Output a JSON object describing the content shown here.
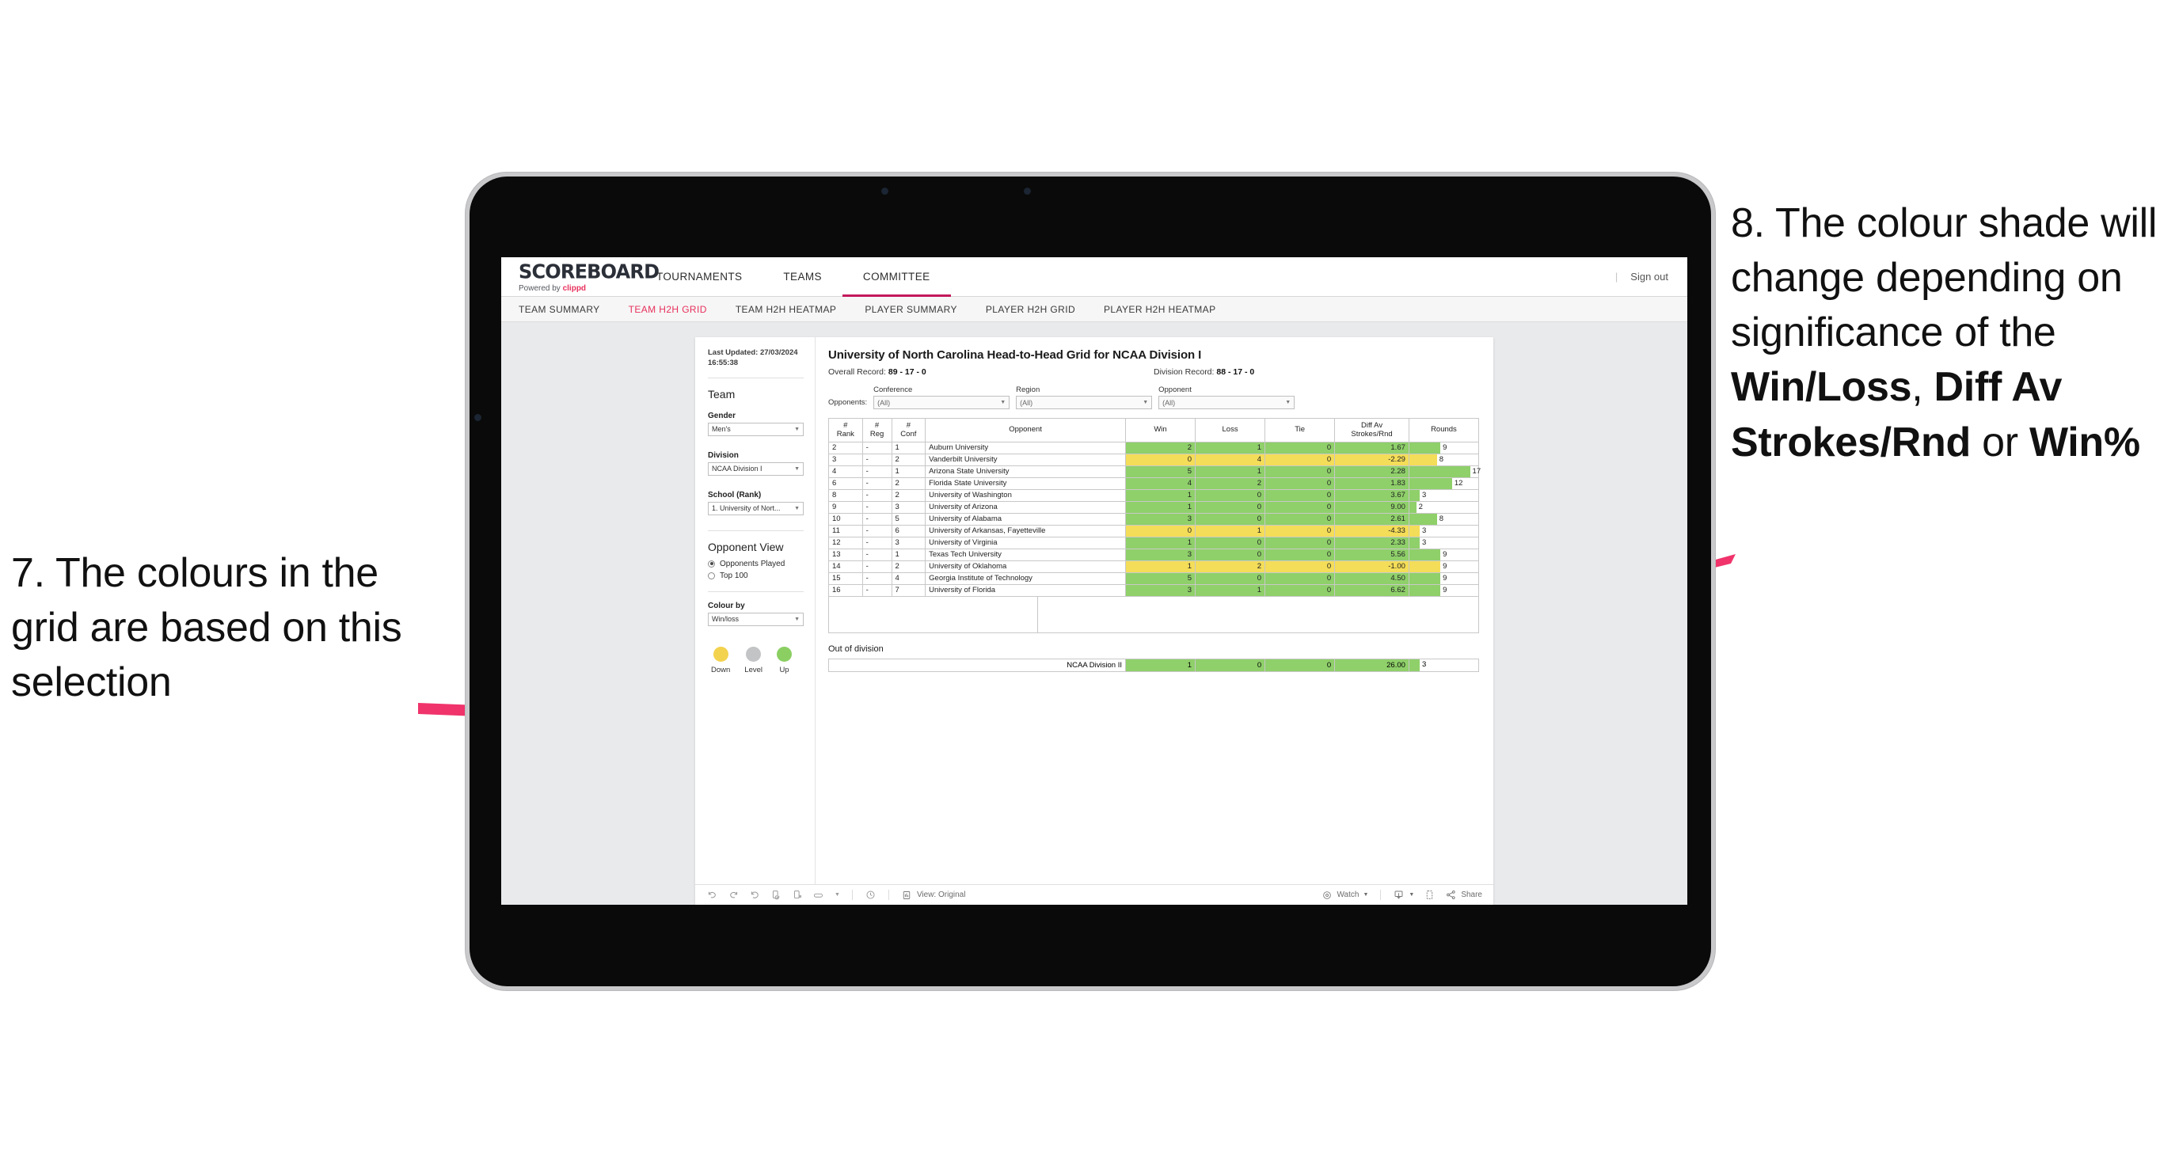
{
  "annotations": {
    "left": {
      "id": "annot-7",
      "text": "7. The colours in the grid are based on this selection"
    },
    "right": {
      "id": "annot-8",
      "lead": "8. The colour shade will change depending on significance of the ",
      "bold1": "Win/Loss",
      "mid1": ", ",
      "bold2": "Diff Av Strokes/Rnd",
      "mid2": " or ",
      "bold3": "Win%"
    },
    "accent_color": "#f0336b"
  },
  "app": {
    "brand": {
      "title": "SCOREBOARD",
      "powered_prefix": "Powered by ",
      "powered_name": "clippd"
    },
    "top_nav": [
      {
        "label": "TOURNAMENTS",
        "active": false
      },
      {
        "label": "TEAMS",
        "active": false
      },
      {
        "label": "COMMITTEE",
        "active": true
      }
    ],
    "sign_out": "Sign out",
    "sign_out_divider": "|",
    "sub_nav": [
      {
        "label": "TEAM SUMMARY",
        "active": false
      },
      {
        "label": "TEAM H2H GRID",
        "active": true
      },
      {
        "label": "TEAM H2H HEATMAP",
        "active": false
      },
      {
        "label": "PLAYER SUMMARY",
        "active": false
      },
      {
        "label": "PLAYER H2H GRID",
        "active": false
      },
      {
        "label": "PLAYER H2H HEATMAP",
        "active": false
      }
    ]
  },
  "panel": {
    "last_updated": "Last Updated: 27/03/2024 16:55:38",
    "team_heading": "Team",
    "gender": {
      "label": "Gender",
      "value": "Men's"
    },
    "division": {
      "label": "Division",
      "value": "NCAA Division I"
    },
    "school": {
      "label": "School (Rank)",
      "value": "1. University of Nort..."
    },
    "opponent_view": {
      "heading": "Opponent View",
      "options": [
        {
          "label": "Opponents Played",
          "selected": true
        },
        {
          "label": "Top 100",
          "selected": false
        }
      ]
    },
    "colour_by": {
      "label": "Colour by",
      "value": "Win/loss"
    },
    "legend": [
      {
        "label": "Down",
        "color": "#f3d24e"
      },
      {
        "label": "Level",
        "color": "#c2c4c6"
      },
      {
        "label": "Up",
        "color": "#8bcf63"
      }
    ]
  },
  "content": {
    "title": "University of North Carolina Head-to-Head Grid for NCAA Division I",
    "overall_record": {
      "label": "Overall Record: ",
      "value": "89 - 17 - 0"
    },
    "division_record": {
      "label": "Division Record: ",
      "value": "88 - 17 - 0"
    },
    "opponents_label": "Opponents:",
    "filters": [
      {
        "label": "Conference",
        "value": "(All)"
      },
      {
        "label": "Region",
        "value": "(All)"
      },
      {
        "label": "Opponent",
        "value": "(All)"
      }
    ],
    "table": {
      "headers": [
        "# Rank",
        "# Reg",
        "# Conf",
        "Opponent",
        "Win",
        "Loss",
        "Tie",
        "Diff Av Strokes/Rnd",
        "Rounds"
      ],
      "header_lines": [
        [
          "#",
          "Rank"
        ],
        [
          "#",
          "Reg"
        ],
        [
          "#",
          "Conf"
        ],
        [
          "Opponent"
        ],
        [
          "Win"
        ],
        [
          "Loss"
        ],
        [
          "Tie"
        ],
        [
          "Diff Av",
          "Strokes/Rnd"
        ],
        [
          "Rounds"
        ]
      ],
      "rows": [
        {
          "rank": "2",
          "reg": "-",
          "conf": "1",
          "opponent": "Auburn University",
          "win": "2",
          "loss": "1",
          "tie": "0",
          "diff": "1.67",
          "rounds": "9",
          "bar_pct": 45,
          "result": "win"
        },
        {
          "rank": "3",
          "reg": "-",
          "conf": "2",
          "opponent": "Vanderbilt University",
          "win": "0",
          "loss": "4",
          "tie": "0",
          "diff": "-2.29",
          "rounds": "8",
          "bar_pct": 40,
          "result": "loss"
        },
        {
          "rank": "4",
          "reg": "-",
          "conf": "1",
          "opponent": "Arizona State University",
          "win": "5",
          "loss": "1",
          "tie": "0",
          "diff": "2.28",
          "rounds": "17",
          "bar_pct": 88,
          "result": "win"
        },
        {
          "rank": "6",
          "reg": "-",
          "conf": "2",
          "opponent": "Florida State University",
          "win": "4",
          "loss": "2",
          "tie": "0",
          "diff": "1.83",
          "rounds": "12",
          "bar_pct": 62,
          "result": "win"
        },
        {
          "rank": "8",
          "reg": "-",
          "conf": "2",
          "opponent": "University of Washington",
          "win": "1",
          "loss": "0",
          "tie": "0",
          "diff": "3.67",
          "rounds": "3",
          "bar_pct": 15,
          "result": "win"
        },
        {
          "rank": "9",
          "reg": "-",
          "conf": "3",
          "opponent": "University of Arizona",
          "win": "1",
          "loss": "0",
          "tie": "0",
          "diff": "9.00",
          "rounds": "2",
          "bar_pct": 10,
          "result": "win"
        },
        {
          "rank": "10",
          "reg": "-",
          "conf": "5",
          "opponent": "University of Alabama",
          "win": "3",
          "loss": "0",
          "tie": "0",
          "diff": "2.61",
          "rounds": "8",
          "bar_pct": 40,
          "result": "win"
        },
        {
          "rank": "11",
          "reg": "-",
          "conf": "6",
          "opponent": "University of Arkansas, Fayetteville",
          "win": "0",
          "loss": "1",
          "tie": "0",
          "diff": "-4.33",
          "rounds": "3",
          "bar_pct": 15,
          "result": "loss"
        },
        {
          "rank": "12",
          "reg": "-",
          "conf": "3",
          "opponent": "University of Virginia",
          "win": "1",
          "loss": "0",
          "tie": "0",
          "diff": "2.33",
          "rounds": "3",
          "bar_pct": 15,
          "result": "win"
        },
        {
          "rank": "13",
          "reg": "-",
          "conf": "1",
          "opponent": "Texas Tech University",
          "win": "3",
          "loss": "0",
          "tie": "0",
          "diff": "5.56",
          "rounds": "9",
          "bar_pct": 45,
          "result": "win"
        },
        {
          "rank": "14",
          "reg": "-",
          "conf": "2",
          "opponent": "University of Oklahoma",
          "win": "1",
          "loss": "2",
          "tie": "0",
          "diff": "-1.00",
          "rounds": "9",
          "bar_pct": 45,
          "result": "loss"
        },
        {
          "rank": "15",
          "reg": "-",
          "conf": "4",
          "opponent": "Georgia Institute of Technology",
          "win": "5",
          "loss": "0",
          "tie": "0",
          "diff": "4.50",
          "rounds": "9",
          "bar_pct": 45,
          "result": "win"
        },
        {
          "rank": "16",
          "reg": "-",
          "conf": "7",
          "opponent": "University of Florida",
          "win": "3",
          "loss": "1",
          "tie": "0",
          "diff": "6.62",
          "rounds": "9",
          "bar_pct": 45,
          "result": "win"
        }
      ]
    },
    "out_of_division": {
      "title": "Out of division",
      "row": {
        "name": "NCAA Division II",
        "win": "1",
        "loss": "0",
        "tie": "0",
        "diff": "26.00",
        "rounds": "3",
        "bar_pct": 15
      }
    }
  },
  "toolbar": {
    "icons": [
      "undo-icon",
      "redo-icon",
      "revert-icon",
      "refresh-data-icon",
      "pause-icon",
      "highlight-icon"
    ],
    "view_label": "View: Original",
    "watch_label": "Watch",
    "share_label": "Share"
  },
  "chart_data": {
    "type": "table",
    "title": "University of North Carolina Head-to-Head Grid for NCAA Division I",
    "columns": [
      "# Rank",
      "# Reg",
      "# Conf",
      "Opponent",
      "Win",
      "Loss",
      "Tie",
      "Diff Av Strokes/Rnd",
      "Rounds"
    ],
    "rows": [
      [
        "2",
        "-",
        "1",
        "Auburn University",
        2,
        1,
        0,
        1.67,
        9
      ],
      [
        "3",
        "-",
        "2",
        "Vanderbilt University",
        0,
        4,
        0,
        -2.29,
        8
      ],
      [
        "4",
        "-",
        "1",
        "Arizona State University",
        5,
        1,
        0,
        2.28,
        17
      ],
      [
        "6",
        "-",
        "2",
        "Florida State University",
        4,
        2,
        0,
        1.83,
        12
      ],
      [
        "8",
        "-",
        "2",
        "University of Washington",
        1,
        0,
        0,
        3.67,
        3
      ],
      [
        "9",
        "-",
        "3",
        "University of Arizona",
        1,
        0,
        0,
        9.0,
        2
      ],
      [
        "10",
        "-",
        "5",
        "University of Alabama",
        3,
        0,
        0,
        2.61,
        8
      ],
      [
        "11",
        "-",
        "6",
        "University of Arkansas, Fayetteville",
        0,
        1,
        0,
        -4.33,
        3
      ],
      [
        "12",
        "-",
        "3",
        "University of Virginia",
        1,
        0,
        0,
        2.33,
        3
      ],
      [
        "13",
        "-",
        "1",
        "Texas Tech University",
        3,
        0,
        0,
        5.56,
        9
      ],
      [
        "14",
        "-",
        "2",
        "University of Oklahoma",
        1,
        2,
        0,
        -1.0,
        9
      ],
      [
        "15",
        "-",
        "4",
        "Georgia Institute of Technology",
        5,
        0,
        0,
        4.5,
        9
      ],
      [
        "16",
        "-",
        "7",
        "University of Florida",
        3,
        1,
        0,
        6.62,
        9
      ]
    ],
    "out_of_division_rows": [
      [
        "NCAA Division II",
        1,
        0,
        0,
        26.0,
        3
      ]
    ],
    "colour_encoding": {
      "win": "#8fd06a",
      "loss": "#f4dd58",
      "level": "#c2c4c6"
    },
    "overall_record": "89 - 17 - 0",
    "division_record": "88 - 17 - 0"
  }
}
